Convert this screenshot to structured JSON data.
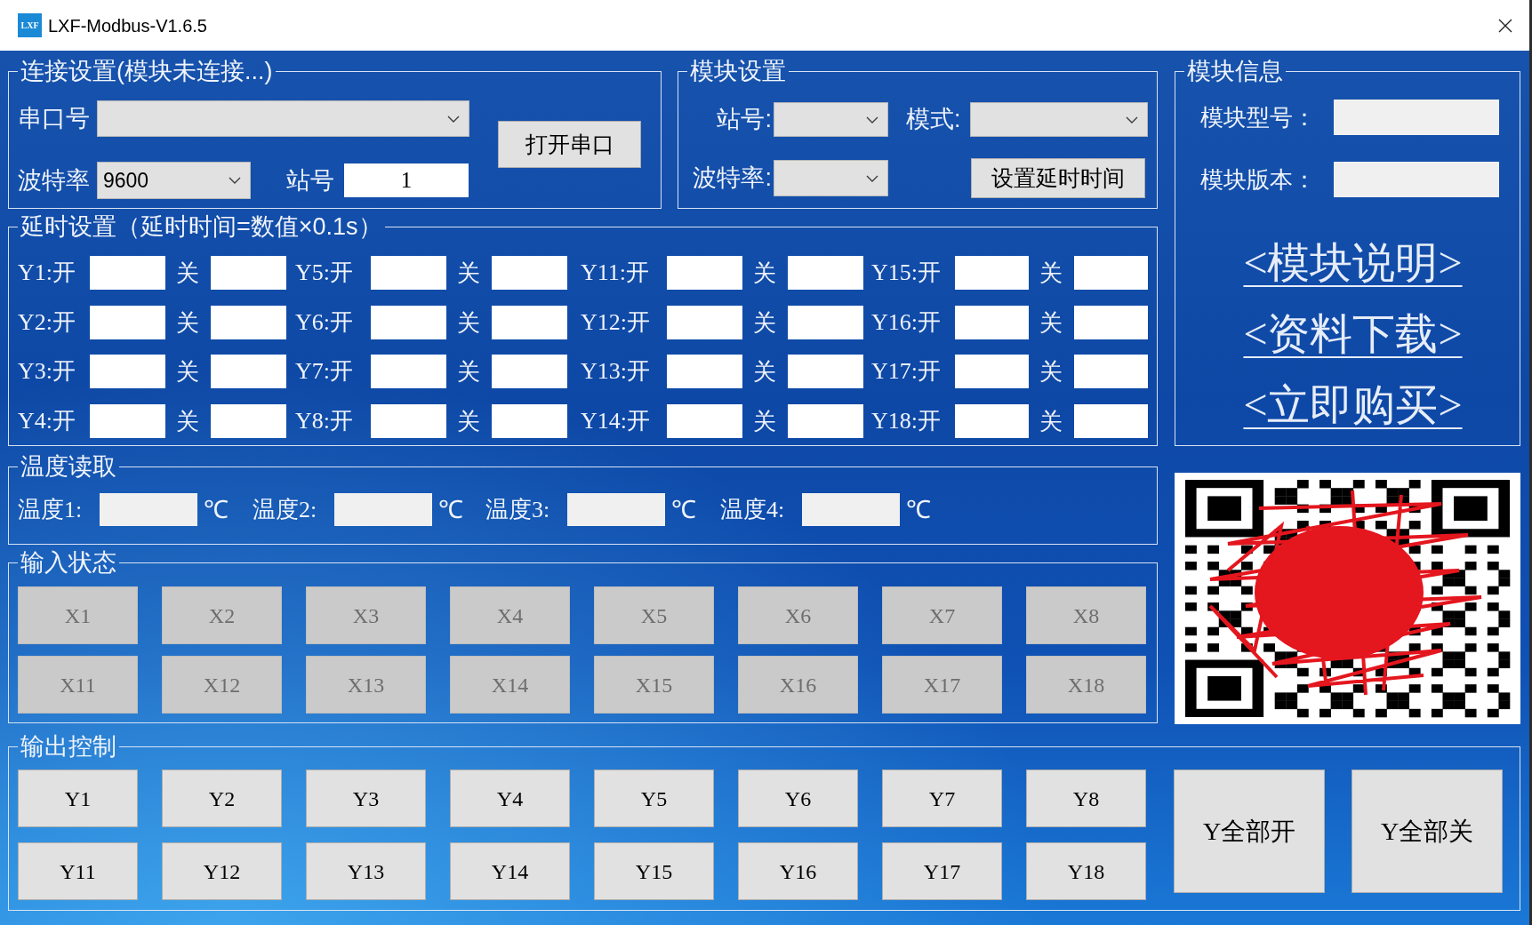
{
  "window": {
    "logo_text": "LXF",
    "title": "LXF-Modbus-V1.6.5"
  },
  "connection": {
    "title": "连接设置(模块未连接...)",
    "rows": [
      [
        {
          "kind": "dropdown",
          "label": "串口号"
        }
      ],
      [
        {
          "kind": "dropdown",
          "label": "波特率",
          "value": "9600"
        },
        {
          "kind": "input",
          "label": "站号",
          "value": "1"
        }
      ]
    ],
    "button": "打开串口"
  },
  "module_settings": {
    "title": "模块设置",
    "rows": [
      [
        {
          "label": "站号:"
        },
        {
          "label": "模式:"
        }
      ],
      [
        {
          "label": "波特率:"
        }
      ]
    ],
    "button": "设置延时时间"
  },
  "module_info": {
    "title": "模块信息",
    "fields": [
      {
        "label": "模块型号："
      },
      {
        "label": "模块版本："
      }
    ],
    "links": [
      "<模块说明>",
      "<资料下载>",
      "<立即购买>"
    ]
  },
  "delay_settings": {
    "title": "延时设置（延时时间=数值×0.1s）",
    "channels": [
      {
        "on_label": "Y1:开",
        "off_label": "关"
      },
      {
        "on_label": "Y5:开",
        "off_label": "关"
      },
      {
        "on_label": "Y11:开",
        "off_label": "关"
      },
      {
        "on_label": "Y15:开",
        "off_label": "关"
      },
      {
        "on_label": "Y2:开",
        "off_label": "关"
      },
      {
        "on_label": "Y6:开",
        "off_label": "关"
      },
      {
        "on_label": "Y12:开",
        "off_label": "关"
      },
      {
        "on_label": "Y16:开",
        "off_label": "关"
      },
      {
        "on_label": "Y3:开",
        "off_label": "关"
      },
      {
        "on_label": "Y7:开",
        "off_label": "关"
      },
      {
        "on_label": "Y13:开",
        "off_label": "关"
      },
      {
        "on_label": "Y17:开",
        "off_label": "关"
      },
      {
        "on_label": "Y4:开",
        "off_label": "关"
      },
      {
        "on_label": "Y8:开",
        "off_label": "关"
      },
      {
        "on_label": "Y14:开",
        "off_label": "关"
      },
      {
        "on_label": "Y18:开",
        "off_label": "关"
      }
    ]
  },
  "temperature": {
    "title": "温度读取",
    "sensors": [
      {
        "label": "温度1:",
        "unit": "℃"
      },
      {
        "label": "温度2:",
        "unit": "℃"
      },
      {
        "label": "温度3:",
        "unit": "℃"
      },
      {
        "label": "温度4:",
        "unit": "℃"
      }
    ]
  },
  "input_status": {
    "title": "输入状态",
    "inputs": [
      {
        "label": "X1",
        "disabled": true
      },
      {
        "label": "X2",
        "disabled": true
      },
      {
        "label": "X3",
        "disabled": true
      },
      {
        "label": "X4",
        "disabled": true
      },
      {
        "label": "X5",
        "disabled": true
      },
      {
        "label": "X6",
        "disabled": true
      },
      {
        "label": "X7",
        "disabled": true
      },
      {
        "label": "X8",
        "disabled": true
      },
      {
        "label": "X11",
        "disabled": true
      },
      {
        "label": "X12",
        "disabled": true
      },
      {
        "label": "X13",
        "disabled": true
      },
      {
        "label": "X14",
        "disabled": true
      },
      {
        "label": "X15",
        "disabled": true
      },
      {
        "label": "X16",
        "disabled": true
      },
      {
        "label": "X17",
        "disabled": true
      },
      {
        "label": "X18",
        "disabled": true
      }
    ]
  },
  "output_control": {
    "title": "输出控制",
    "outputs": [
      "Y1",
      "Y2",
      "Y3",
      "Y4",
      "Y5",
      "Y6",
      "Y7",
      "Y8",
      "Y11",
      "Y12",
      "Y13",
      "Y14",
      "Y15",
      "Y16",
      "Y17",
      "Y18"
    ],
    "all_buttons": [
      "Y全部开",
      "Y全部关"
    ]
  }
}
